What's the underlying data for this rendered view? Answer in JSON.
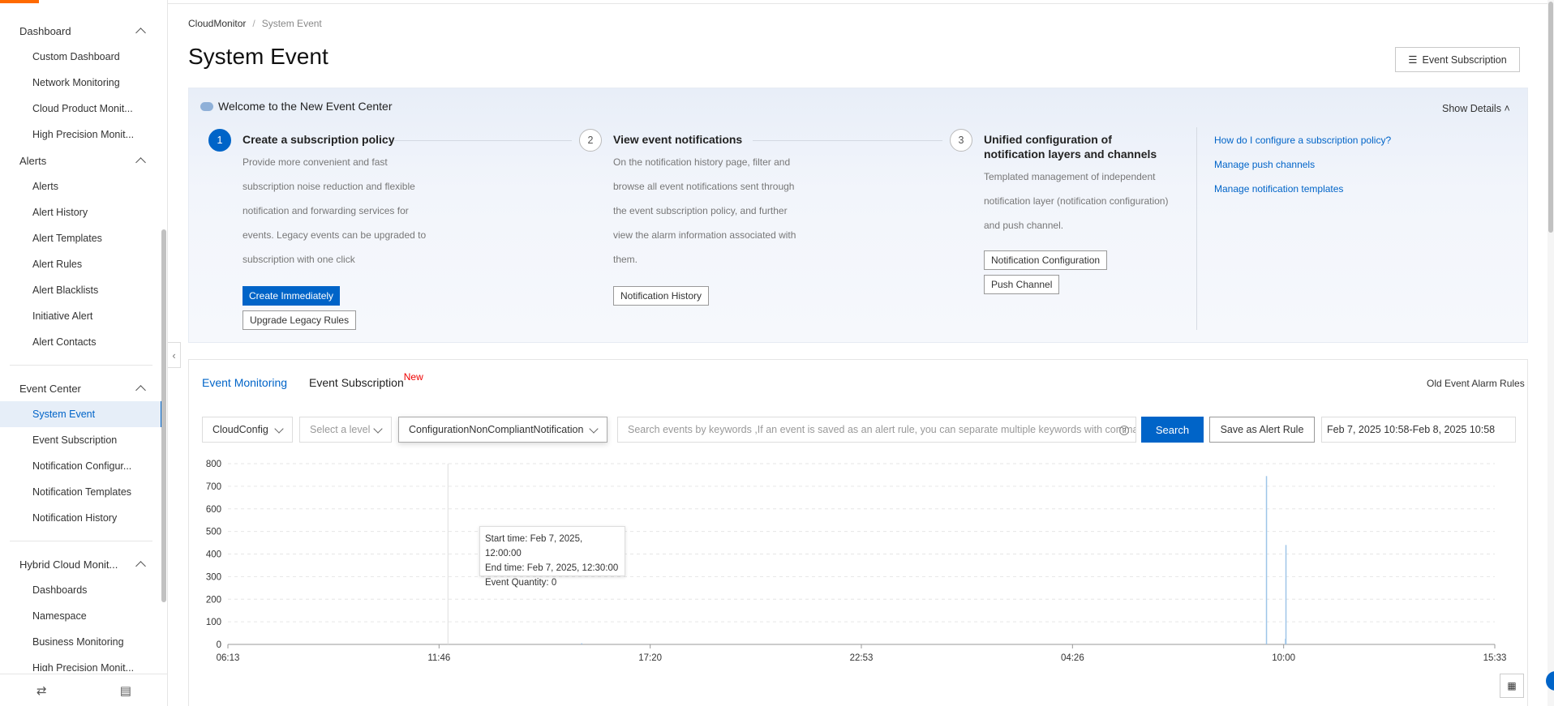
{
  "sidebar": {
    "groups": [
      {
        "label": "Dashboard",
        "items": [
          "Custom Dashboard",
          "Network Monitoring",
          "Cloud Product Monit...",
          "High Precision Monit..."
        ]
      },
      {
        "label": "Alerts",
        "items": [
          "Alerts",
          "Alert History",
          "Alert Templates",
          "Alert Rules",
          "Alert Blacklists",
          "Initiative Alert",
          "Alert Contacts"
        ]
      },
      {
        "label": "Event Center",
        "items": [
          "System Event",
          "Event Subscription",
          "Notification Configur...",
          "Notification Templates",
          "Notification History"
        ]
      },
      {
        "label": "Hybrid Cloud Monit...",
        "items": [
          "Dashboards",
          "Namespace",
          "Business Monitoring",
          "High Precision Monit..."
        ]
      }
    ],
    "active_item": "System Event",
    "bottom": {
      "swap_icon": "⇄",
      "feedback_icon": "▤"
    }
  },
  "header": {
    "breadcrumb": [
      "CloudMonitor",
      "System Event"
    ],
    "breadcrumb_sep": "/",
    "title": "System Event",
    "subscription_button": "Event Subscription"
  },
  "welcome": {
    "title": "Welcome to the New Event Center",
    "show_details": "Show Details",
    "steps": [
      {
        "num": "1",
        "title": "Create a subscription policy",
        "desc": [
          "Provide more convenient and fast",
          "subscription noise reduction and flexible",
          "notification and forwarding services for",
          "events. Legacy events can be upgraded to",
          "subscription with one click"
        ],
        "primary_button": "Create Immediately",
        "button": "Upgrade Legacy Rules"
      },
      {
        "num": "2",
        "title": "View event notifications",
        "desc": [
          "On the notification history page, filter and",
          "browse all event notifications sent through",
          "the event subscription policy, and further",
          "view the alarm information associated with",
          "them."
        ],
        "button": "Notification History"
      },
      {
        "num": "3",
        "title_lines": [
          "Unified configuration of",
          "notification layers and channels"
        ],
        "desc": [
          "Templated management of independent",
          "notification layer (notification configuration)",
          "and push channel."
        ],
        "buttons": [
          "Notification Configuration",
          "Push Channel"
        ]
      }
    ],
    "links": [
      "How do I configure a subscription policy?",
      "Manage push channels",
      "Manage notification templates"
    ]
  },
  "monitor": {
    "tabs": [
      {
        "label": "Event Monitoring",
        "active": true
      },
      {
        "label": "Event Subscription",
        "badge": "New",
        "active": false
      }
    ],
    "old_rules": "Old Event Alarm Rules",
    "filters": {
      "product": "CloudConfig",
      "level_placeholder": "Select a level",
      "event_name": "ConfigurationNonCompliantNotification",
      "search_placeholder": "Search events by keywords ,If an event is saved as an alert rule, you can separate multiple keywords with comma",
      "search_button": "Search",
      "save_button": "Save as Alert Rule",
      "date_range": "Feb 7, 2025 10:58-Feb 8, 2025 10:58"
    },
    "tooltip": {
      "start": "Start time: Feb 7, 2025, 12:00:00",
      "end": "End time: Feb 7, 2025, 12:30:00",
      "quantity": "Event Quantity: 0"
    }
  },
  "chart_data": {
    "type": "bar",
    "x_tick_labels": [
      "06:13",
      "11:46",
      "17:20",
      "22:53",
      "04:26",
      "10:00",
      "15:33"
    ],
    "ylim": [
      0,
      800
    ],
    "y_ticks": [
      0,
      100,
      200,
      300,
      400,
      500,
      600,
      700,
      800
    ],
    "series": [
      {
        "values": [
          {
            "x": "Feb 7 15:30",
            "y": 5
          },
          {
            "x": "Feb 8 09:30",
            "y": 745
          },
          {
            "x": "Feb 8 09:30",
            "y": 440
          },
          {
            "x": "Feb 8 10:00",
            "y": 25
          }
        ]
      }
    ],
    "hover_x": "Feb 7 12:00",
    "grid": true,
    "bar_color": "#9ec5e8"
  }
}
